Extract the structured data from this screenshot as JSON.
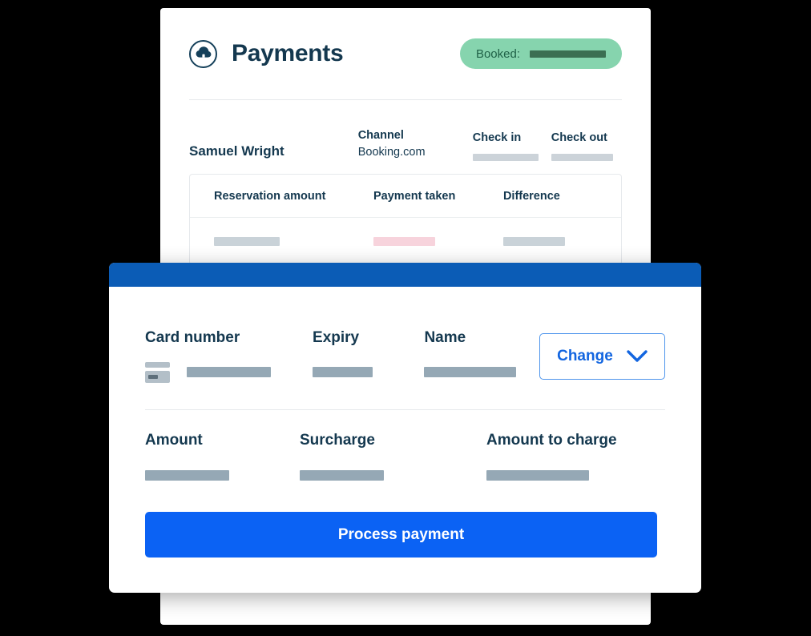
{
  "panel": {
    "icon": "cloud-house-icon",
    "title": "Payments",
    "status": {
      "label": "Booked:",
      "value_redacted": true
    },
    "guest": {
      "name": "Samuel Wright"
    },
    "meta": [
      {
        "label": "Channel",
        "value": "Booking.com",
        "redacted": false
      },
      {
        "label": "Check in",
        "value": "",
        "redacted": true
      },
      {
        "label": "Check out",
        "value": "",
        "redacted": true
      }
    ],
    "reservation_table": {
      "columns": [
        "Reservation amount",
        "Payment taken",
        "Difference"
      ],
      "rows": [
        {
          "reservation_amount": "",
          "payment_taken": "",
          "difference": "",
          "redacted": true
        }
      ]
    }
  },
  "modal": {
    "card_section": {
      "card_icon": "credit-card-icon",
      "fields": [
        {
          "label": "Card number",
          "value": "",
          "redacted": true
        },
        {
          "label": "Expiry",
          "value": "",
          "redacted": true
        },
        {
          "label": "Name",
          "value": "",
          "redacted": true
        }
      ],
      "change_button": {
        "label": "Change",
        "icon": "chevron-down-icon"
      }
    },
    "amount_section": {
      "fields": [
        {
          "label": "Amount",
          "value": "",
          "redacted": true
        },
        {
          "label": "Surcharge",
          "value": "",
          "redacted": true
        },
        {
          "label": "Amount to charge",
          "value": "",
          "redacted": true
        }
      ]
    },
    "primary_action": {
      "label": "Process payment"
    }
  },
  "colors": {
    "navy_text": "#14384f",
    "badge_green": "#86d4ae",
    "badge_text_green": "#1f6147",
    "modal_titlebar_blue": "#0b5cb6",
    "primary_blue": "#0b62f4",
    "link_blue": "#1265e0",
    "redacted_grey": "#95a8b5",
    "redacted_light_grey": "#c9d2d8",
    "redacted_pink": "#f7d3dc",
    "page_background": "#000000"
  }
}
